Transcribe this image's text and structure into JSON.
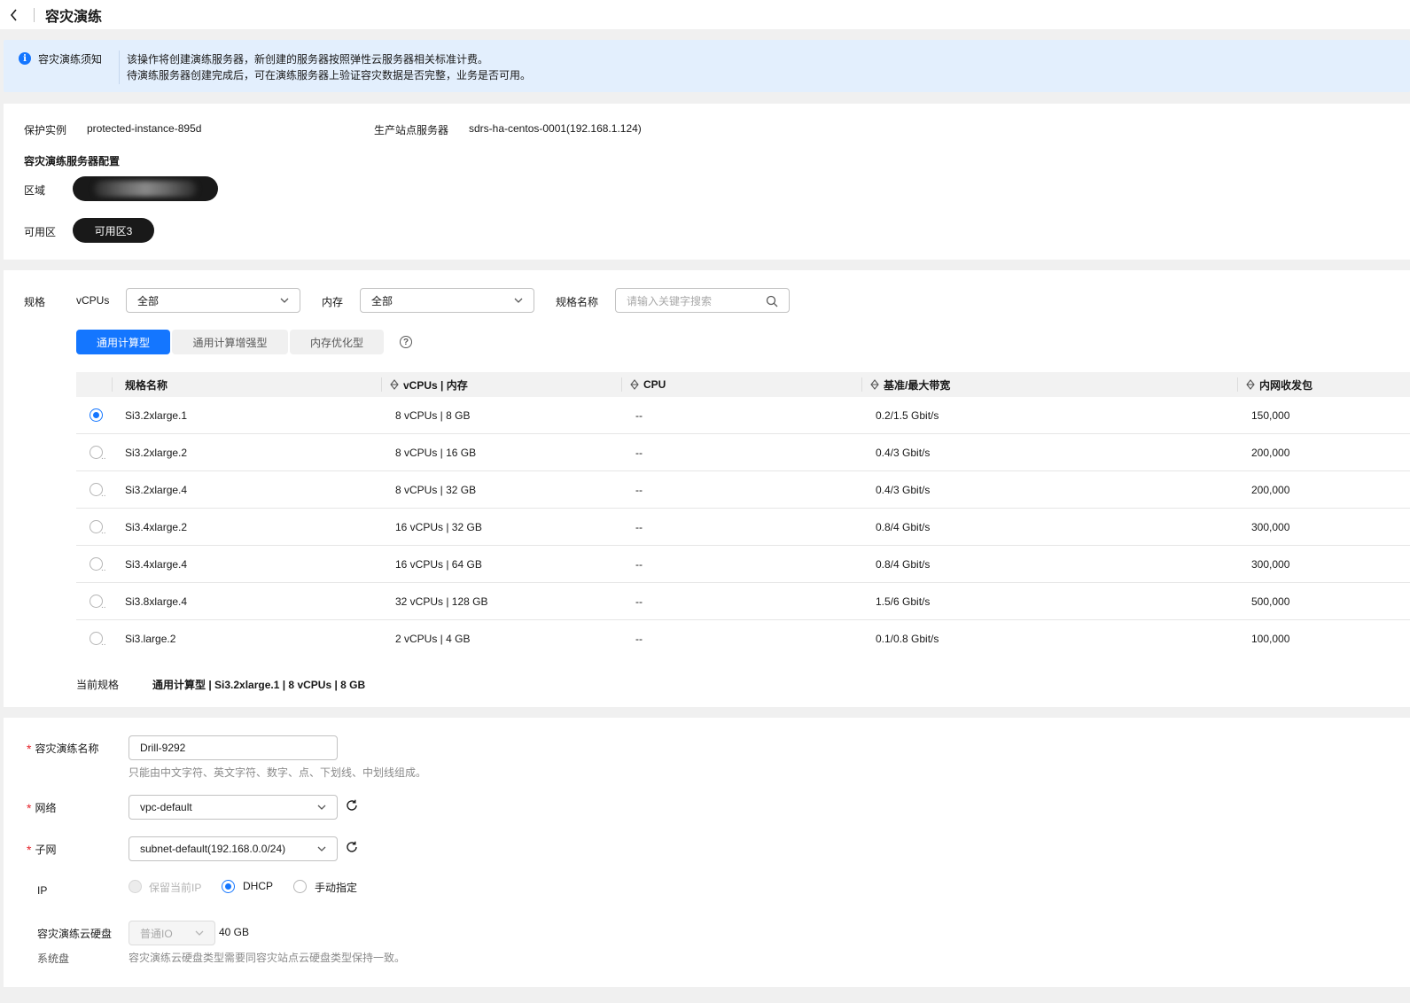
{
  "header": {
    "title": "容灾演练"
  },
  "notice": {
    "title": "容灾演练须知",
    "line1": "该操作将创建演练服务器，新创建的服务器按照弹性云服务器相关标准计费。",
    "line2": "待演练服务器创建完成后，可在演练服务器上验证容灾数据是否完整，业务是否可用。"
  },
  "info": {
    "protected_label": "保护实例",
    "protected_value": "protected-instance-895d",
    "prod_label": "生产站点服务器",
    "prod_value": "sdrs-ha-centos-0001(192.168.1.124)",
    "config_title": "容灾演练服务器配置",
    "region_label": "区域",
    "az_label": "可用区",
    "az_value": "可用区3"
  },
  "spec": {
    "label": "规格",
    "vcpus_label": "vCPUs",
    "vcpus_value": "全部",
    "memory_label": "内存",
    "memory_value": "全部",
    "name_label": "规格名称",
    "search_placeholder": "请输入关键字搜索",
    "tabs": [
      "通用计算型",
      "通用计算增强型",
      "内存优化型"
    ],
    "help": "?",
    "columns": [
      "规格名称",
      "vCPUs | 内存",
      "CPU",
      "基准/最大带宽",
      "内网收发包"
    ],
    "rows": [
      {
        "name": "Si3.2xlarge.1",
        "vcpu_mem": "8 vCPUs | 8 GB",
        "cpu": "--",
        "bandwidth": "0.2/1.5 Gbit/s",
        "pps": "150,000",
        "selected": true
      },
      {
        "name": "Si3.2xlarge.2",
        "vcpu_mem": "8 vCPUs | 16 GB",
        "cpu": "--",
        "bandwidth": "0.4/3 Gbit/s",
        "pps": "200,000",
        "selected": false
      },
      {
        "name": "Si3.2xlarge.4",
        "vcpu_mem": "8 vCPUs | 32 GB",
        "cpu": "--",
        "bandwidth": "0.4/3 Gbit/s",
        "pps": "200,000",
        "selected": false
      },
      {
        "name": "Si3.4xlarge.2",
        "vcpu_mem": "16 vCPUs | 32 GB",
        "cpu": "--",
        "bandwidth": "0.8/4 Gbit/s",
        "pps": "300,000",
        "selected": false
      },
      {
        "name": "Si3.4xlarge.4",
        "vcpu_mem": "16 vCPUs | 64 GB",
        "cpu": "--",
        "bandwidth": "0.8/4 Gbit/s",
        "pps": "300,000",
        "selected": false
      },
      {
        "name": "Si3.8xlarge.4",
        "vcpu_mem": "32 vCPUs | 128 GB",
        "cpu": "--",
        "bandwidth": "1.5/6 Gbit/s",
        "pps": "500,000",
        "selected": false
      },
      {
        "name": "Si3.large.2",
        "vcpu_mem": "2 vCPUs | 4 GB",
        "cpu": "--",
        "bandwidth": "0.1/0.8 Gbit/s",
        "pps": "100,000",
        "selected": false
      }
    ],
    "current_label": "当前规格",
    "current_value": "通用计算型 | Si3.2xlarge.1 | 8 vCPUs | 8 GB"
  },
  "form": {
    "required_mark": "*",
    "name_label": "容灾演练名称",
    "name_value": "Drill-9292",
    "name_hint": "只能由中文字符、英文字符、数字、点、下划线、中划线组成。",
    "network_label": "网络",
    "network_value": "vpc-default",
    "subnet_label": "子网",
    "subnet_value": "subnet-default(192.168.0.0/24)",
    "ip_label": "IP",
    "ip_options": [
      "保留当前IP",
      "DHCP",
      "手动指定"
    ],
    "disk_label": "容灾演练云硬盘",
    "disk_type": "普通IO",
    "disk_size": "40 GB",
    "system_disk_label": "系统盘",
    "disk_hint": "容灾演练云硬盘类型需要同容灾站点云硬盘类型保持一致。"
  },
  "colors": {
    "accent": "#1476ff",
    "notice_bg": "#e3effd",
    "required": "#e5242b"
  }
}
